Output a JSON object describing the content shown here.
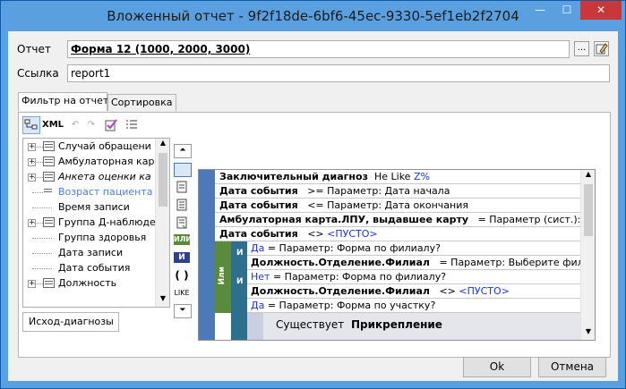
{
  "window": {
    "title": "Вложенный отчет - 9f2f18de-6bf6-45ec-9330-5ef1eb2f2704",
    "controls": {
      "minimize": "—",
      "maximize": "☐",
      "close": "✕"
    }
  },
  "form": {
    "report_label": "Отчет",
    "report_value": "Форма 12 (1000, 2000, 3000)",
    "link_label": "Ссылка",
    "link_value": "report1",
    "browse_button": "...",
    "edit_icon": "pencil-icon"
  },
  "tabs": [
    {
      "label": "Фильтр на отчет",
      "active": true
    },
    {
      "label": "Сортировка",
      "active": false
    }
  ],
  "toolbar": {
    "xml_label": "XML"
  },
  "tree": [
    {
      "label": "Случай обращени",
      "expandable": true
    },
    {
      "label": "Амбулаторная кар",
      "expandable": true
    },
    {
      "label": "Анкета оценки ка",
      "expandable": true,
      "italic": true
    },
    {
      "label": "Возраст пациента",
      "expandable": false,
      "highlight": true
    },
    {
      "label": "Время записи",
      "expandable": false
    },
    {
      "label": "Группа Д-наблюде",
      "expandable": true
    },
    {
      "label": "Группа здоровья",
      "expandable": false
    },
    {
      "label": "Дата записи",
      "expandable": false
    },
    {
      "label": "Дата события",
      "expandable": false
    },
    {
      "label": "Должность",
      "expandable": true
    }
  ],
  "bottom_tab": "Исход-диагнозы",
  "middle_tools": {
    "or_label": "ИЛИ",
    "and_label": "И",
    "parens_label": "( )",
    "like_label": "LIKE"
  },
  "conditions": [
    {
      "field": "Заключительный диагноз",
      "op": "He Like",
      "value": "Z%"
    },
    {
      "field": "Дата события",
      "op": ">=",
      "value": "Параметр: Дата начала"
    },
    {
      "field": "Дата события",
      "op": "<=",
      "value": "Параметр: Дата окончания"
    },
    {
      "field": "Амбулаторная карта.ЛПУ, выдавшее карту",
      "op": "=",
      "value": "Параметр (сист.):"
    },
    {
      "field": "Дата события",
      "op": "<>",
      "value": "<ПУСТО>"
    }
  ],
  "or_group": {
    "or_tag": "Или",
    "and_tag": "И",
    "rows": [
      {
        "cond_label": "Да",
        "cond_text": "= Параметр: Форма по филиалу?"
      },
      {
        "field": "Должность.Отделение.Филиал",
        "op": "=",
        "value": "Параметр: Выберите фил"
      },
      {
        "cond_label": "Нет",
        "cond_text": "= Параметр: Форма по филиалу?"
      },
      {
        "field": "Должность.Отделение.Филиал",
        "op": "<>",
        "value": "<ПУСТО>"
      },
      {
        "cond_label": "Да",
        "cond_text": "= Параметр: Форма по участку?"
      }
    ]
  },
  "exists_block": {
    "prefix": "Существует",
    "entity": "Прикрепление"
  },
  "buttons": {
    "ok": "Ok",
    "cancel": "Отмена"
  },
  "colors": {
    "titlebar": "#5aa0e0",
    "close": "#c8383a",
    "gutter": "#4c7ab8",
    "green_gutter": "#5a8a3c",
    "link_blue": "#1a35d8"
  }
}
